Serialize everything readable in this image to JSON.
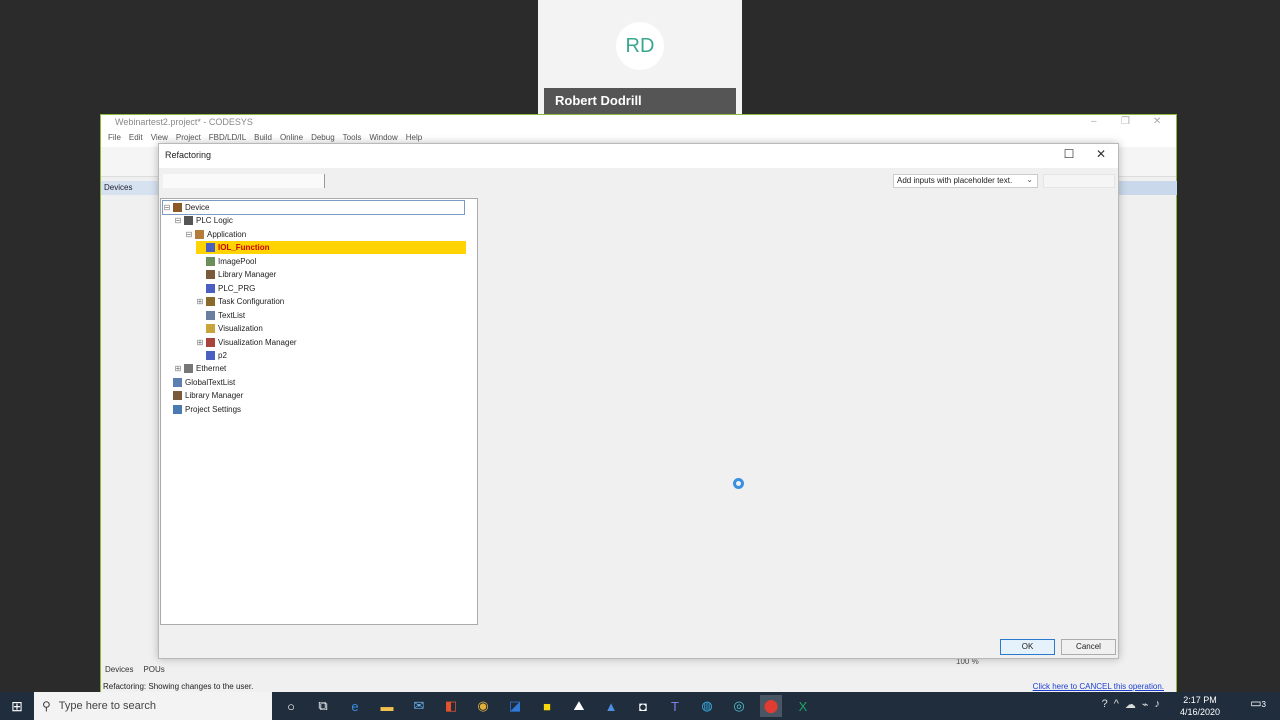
{
  "participant": {
    "initials": "RD",
    "name": "Robert Dodrill"
  },
  "main_window": {
    "title": "Webinartest2.project* - CODESYS",
    "menu": [
      "File",
      "Edit",
      "View",
      "Project",
      "FBD/LD/IL",
      "Build",
      "Online",
      "Debug",
      "Tools",
      "Window",
      "Help"
    ],
    "devices_panel_title": "Devices",
    "bottom_tabs": [
      "Devices",
      "POUs"
    ],
    "zoom": "100 %",
    "status_text": "Refactoring: Showing changes to the user.",
    "cancel_link": "Click here to CANCEL this operation."
  },
  "dialog": {
    "title": "Refactoring",
    "dropdown_value": "Add inputs with placeholder text.",
    "ok_label": "OK",
    "cancel_label": "Cancel",
    "tree": [
      {
        "label": "Device",
        "depth": 0,
        "expander": "-",
        "icon": "device-icon"
      },
      {
        "label": "PLC Logic",
        "depth": 1,
        "expander": "-",
        "icon": "plc-logic-icon"
      },
      {
        "label": "Application",
        "depth": 2,
        "expander": "-",
        "icon": "application-icon"
      },
      {
        "label": "IOL_Function",
        "depth": 3,
        "expander": "",
        "icon": "pou-icon",
        "selected": true
      },
      {
        "label": "ImagePool",
        "depth": 3,
        "expander": "",
        "icon": "image-pool-icon"
      },
      {
        "label": "Library Manager",
        "depth": 3,
        "expander": "",
        "icon": "library-icon"
      },
      {
        "label": "PLC_PRG",
        "depth": 3,
        "expander": "",
        "icon": "pou-icon"
      },
      {
        "label": "Task Configuration",
        "depth": 3,
        "expander": "+",
        "icon": "task-config-icon"
      },
      {
        "label": "TextList",
        "depth": 3,
        "expander": "",
        "icon": "textlist-icon"
      },
      {
        "label": "Visualization",
        "depth": 3,
        "expander": "",
        "icon": "visualization-icon"
      },
      {
        "label": "Visualization Manager",
        "depth": 3,
        "expander": "+",
        "icon": "visu-manager-icon"
      },
      {
        "label": "p2",
        "depth": 3,
        "expander": "",
        "icon": "pou-icon"
      },
      {
        "label": "Ethernet",
        "depth": 1,
        "expander": "+",
        "icon": "ethernet-icon"
      },
      {
        "label": "GlobalTextList",
        "depth": 0,
        "expander": "",
        "icon": "global-textlist-icon"
      },
      {
        "label": "Library Manager",
        "depth": 0,
        "expander": "",
        "icon": "library-icon"
      },
      {
        "label": "Project Settings",
        "depth": 0,
        "expander": "",
        "icon": "settings-icon"
      }
    ]
  },
  "taskbar": {
    "search_placeholder": "Type here to search",
    "time": "2:17 PM",
    "date": "4/16/2020",
    "notification_count": "3"
  },
  "colors": {
    "selection": "#ffd400",
    "selection_text": "#cc0000",
    "accent_border": "#8fb93b",
    "spinner": "#3a8fe0"
  }
}
